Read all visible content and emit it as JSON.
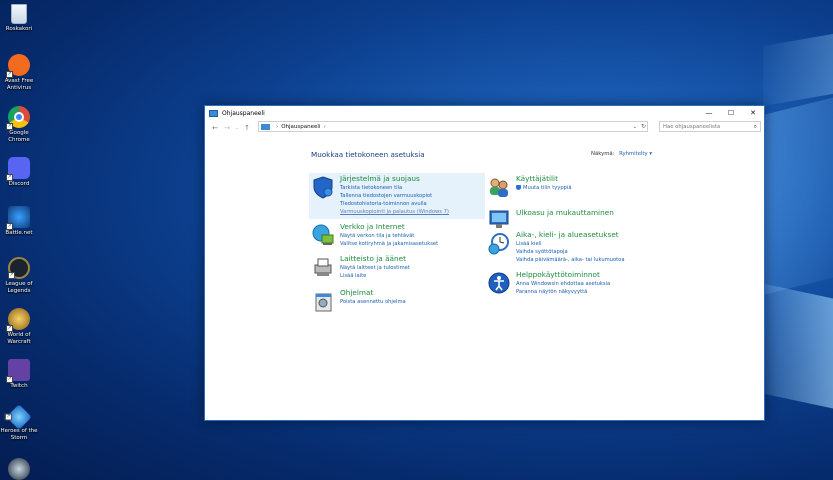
{
  "desktop": {
    "icons": [
      {
        "label": "Roskakori",
        "icon": "recycle-bin-icon",
        "color": "#d9e6f2"
      },
      {
        "label": "Avast Free Antivirus",
        "icon": "avast-icon",
        "color": "#f36a21"
      },
      {
        "label": "Google Chrome",
        "icon": "chrome-icon",
        "color": "#dd4b39"
      },
      {
        "label": "Discord",
        "icon": "discord-icon",
        "color": "#5865f2"
      },
      {
        "label": "Battle.net",
        "icon": "battlenet-icon",
        "color": "#0f3b78"
      },
      {
        "label": "League of Legends",
        "icon": "league-of-legends-icon",
        "color": "#a08440"
      },
      {
        "label": "World of Warcraft",
        "icon": "world-of-warcraft-icon",
        "color": "#c79a2e"
      },
      {
        "label": "Twitch",
        "icon": "twitch-icon",
        "color": "#6441a5"
      },
      {
        "label": "Heroes of the Storm",
        "icon": "heroes-of-the-storm-icon",
        "color": "#2a9bd8"
      },
      {
        "label": "",
        "icon": "steam-icon",
        "color": "#1b2838"
      }
    ]
  },
  "window": {
    "title": "Ohjauspaneeli",
    "address": {
      "path": "Ohjauspaneeli",
      "separator": "›"
    },
    "search": {
      "placeholder": "Hae ohjauspaneelista"
    },
    "heading": "Muokkaa tietokoneen asetuksia",
    "view_by": {
      "label": "Näkymä:",
      "value": "Ryhmitelty ▾"
    },
    "categories_left": [
      {
        "title": "Järjestelmä ja suojaus",
        "icon": "shield-system-icon",
        "links": [
          "Tarkista tietokoneen tila",
          "Tallenna tiedostojen varmuuskopiot Tiedostohistoria-toiminnon avulla",
          "Varmuuskopiointi ja palautus (Windows 7)"
        ]
      },
      {
        "title": "Verkko ja Internet",
        "icon": "network-icon",
        "links": [
          "Näytä verkon tila ja tehtävät",
          "Valitse kotiryhmä ja jakamisasetukset"
        ]
      },
      {
        "title": "Laitteisto ja äänet",
        "icon": "hardware-sound-icon",
        "links": [
          "Näytä laitteet ja tulostimet",
          "Lisää laite"
        ]
      },
      {
        "title": "Ohjelmat",
        "icon": "programs-icon",
        "links": [
          "Poista asennettu ohjelma"
        ]
      }
    ],
    "categories_right": [
      {
        "title": "Käyttäjätilit",
        "icon": "user-accounts-icon",
        "links": [
          "Muuta tilin tyyppiä"
        ]
      },
      {
        "title": "Ulkoasu ja mukauttaminen",
        "icon": "appearance-icon",
        "links": []
      },
      {
        "title": "Aika-, kieli- ja alueasetukset",
        "icon": "clock-region-icon",
        "links": [
          "Lisää kieli",
          "Vaihda syöttötapoja",
          "Vaihda päivämäärä-, aika- tai lukumuotoa"
        ]
      },
      {
        "title": "Helppokäyttötoiminnot",
        "icon": "ease-of-access-icon",
        "links": [
          "Anna Windowsin ehdottaa asetuksia",
          "Paranna näytön näkyvyyttä"
        ]
      }
    ]
  }
}
